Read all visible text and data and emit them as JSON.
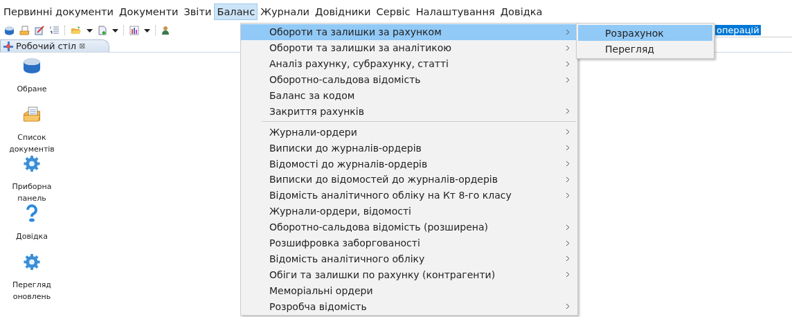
{
  "menubar": [
    {
      "label": "Первинні документи",
      "selected": false
    },
    {
      "label": "Документи",
      "selected": false
    },
    {
      "label": "Звіти",
      "selected": false
    },
    {
      "label": "Баланс",
      "selected": true
    },
    {
      "label": "Журнали",
      "selected": false
    },
    {
      "label": "Довідники",
      "selected": false
    },
    {
      "label": "Сервіс",
      "selected": false
    },
    {
      "label": "Налаштування",
      "selected": false
    },
    {
      "label": "Довідка",
      "selected": false
    }
  ],
  "tab": {
    "label": "Робочий стіл",
    "close": "⊠"
  },
  "desktop_items": [
    {
      "label": "Обране"
    },
    {
      "label": "Список документів"
    },
    {
      "label": "Приборна панель"
    },
    {
      "label": "Довідка"
    },
    {
      "label": "Перегляд оновлень"
    }
  ],
  "background_field": {
    "selected_text": "операцій"
  },
  "menu": [
    {
      "kind": "item",
      "label": "Обороти та залишки за рахунком",
      "submenu": true,
      "selected": true
    },
    {
      "kind": "item",
      "label": "Обороти та залишки за аналітикою",
      "submenu": true,
      "selected": false
    },
    {
      "kind": "item",
      "label": "Аналіз рахунку, субрахунку, статті",
      "submenu": true,
      "selected": false
    },
    {
      "kind": "item",
      "label": "Оборотно-сальдова відомість",
      "submenu": true,
      "selected": false
    },
    {
      "kind": "item",
      "label": "Баланс за кодом",
      "submenu": false,
      "selected": false
    },
    {
      "kind": "item",
      "label": "Закриття рахунків",
      "submenu": true,
      "selected": false
    },
    {
      "kind": "separator"
    },
    {
      "kind": "item",
      "label": "Журнали-ордери",
      "submenu": true,
      "selected": false
    },
    {
      "kind": "item",
      "label": "Виписки до журналів-ордерів",
      "submenu": true,
      "selected": false
    },
    {
      "kind": "item",
      "label": "Відомості до журналів-ордерів",
      "submenu": true,
      "selected": false
    },
    {
      "kind": "item",
      "label": "Виписки до відомостей до журналів-ордерів",
      "submenu": true,
      "selected": false
    },
    {
      "kind": "item",
      "label": "Відомість аналітичного обліку на Кт 8-го класу",
      "submenu": true,
      "selected": false
    },
    {
      "kind": "item",
      "label": "Журнали-ордери, відомості",
      "submenu": false,
      "selected": false
    },
    {
      "kind": "item",
      "label": "Оборотно-сальдова відомість (розширена)",
      "submenu": true,
      "selected": false
    },
    {
      "kind": "item",
      "label": "Розшифровка заборгованості",
      "submenu": true,
      "selected": false
    },
    {
      "kind": "item",
      "label": "Відомість аналітичного обліку",
      "submenu": true,
      "selected": false
    },
    {
      "kind": "item",
      "label": "Обіги та залишки по рахунку (контрагенти)",
      "submenu": true,
      "selected": false
    },
    {
      "kind": "item",
      "label": "Меморіальні ордери",
      "submenu": false,
      "selected": false
    },
    {
      "kind": "item",
      "label": "Розробча відомість",
      "submenu": true,
      "selected": false
    }
  ],
  "submenu": [
    {
      "label": "Розрахунок",
      "selected": true
    },
    {
      "label": "Перегляд",
      "selected": false
    }
  ]
}
